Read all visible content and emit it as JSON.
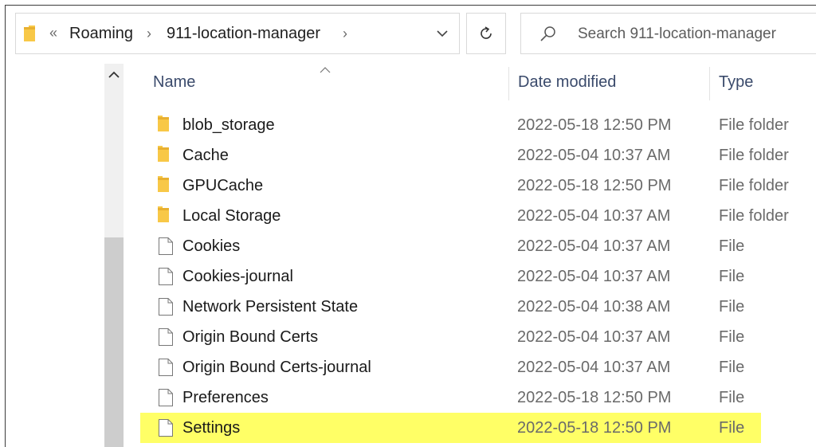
{
  "address_bar": {
    "overflow_glyph": "«",
    "crumbs": [
      "Roaming",
      "911-location-manager"
    ],
    "separator_glyph": "›",
    "dropdown_icon": "chevron-down-icon",
    "folder_icon": "folder-icon"
  },
  "refresh": {
    "icon": "refresh-icon"
  },
  "search": {
    "placeholder": "Search 911-location-manager",
    "icon": "search-icon"
  },
  "columns": {
    "name": "Name",
    "date_modified": "Date modified",
    "type": "Type",
    "sort_icon": "sort-up-caret-icon"
  },
  "rows": [
    {
      "name": "blob_storage",
      "date": "2022-05-18 12:50 PM",
      "type": "File folder",
      "icon": "folder-icon"
    },
    {
      "name": "Cache",
      "date": "2022-05-04 10:37 AM",
      "type": "File folder",
      "icon": "folder-icon"
    },
    {
      "name": "GPUCache",
      "date": "2022-05-18 12:50 PM",
      "type": "File folder",
      "icon": "folder-icon"
    },
    {
      "name": "Local Storage",
      "date": "2022-05-04 10:37 AM",
      "type": "File folder",
      "icon": "folder-icon"
    },
    {
      "name": "Cookies",
      "date": "2022-05-04 10:37 AM",
      "type": "File",
      "icon": "file-icon"
    },
    {
      "name": "Cookies-journal",
      "date": "2022-05-04 10:37 AM",
      "type": "File",
      "icon": "file-icon"
    },
    {
      "name": "Network Persistent State",
      "date": "2022-05-04 10:38 AM",
      "type": "File",
      "icon": "file-icon"
    },
    {
      "name": "Origin Bound Certs",
      "date": "2022-05-04 10:37 AM",
      "type": "File",
      "icon": "file-icon"
    },
    {
      "name": "Origin Bound Certs-journal",
      "date": "2022-05-04 10:37 AM",
      "type": "File",
      "icon": "file-icon"
    },
    {
      "name": "Preferences",
      "date": "2022-05-18 12:50 PM",
      "type": "File",
      "icon": "file-icon"
    },
    {
      "name": "Settings",
      "date": "2022-05-18 12:50 PM",
      "type": "File",
      "icon": "file-icon",
      "highlighted": true
    }
  ],
  "colors": {
    "highlight": "#ffff66",
    "folder_yellow": "#f8c847",
    "header_text": "#3a4a6b",
    "secondary_text": "#6a6a6a"
  }
}
